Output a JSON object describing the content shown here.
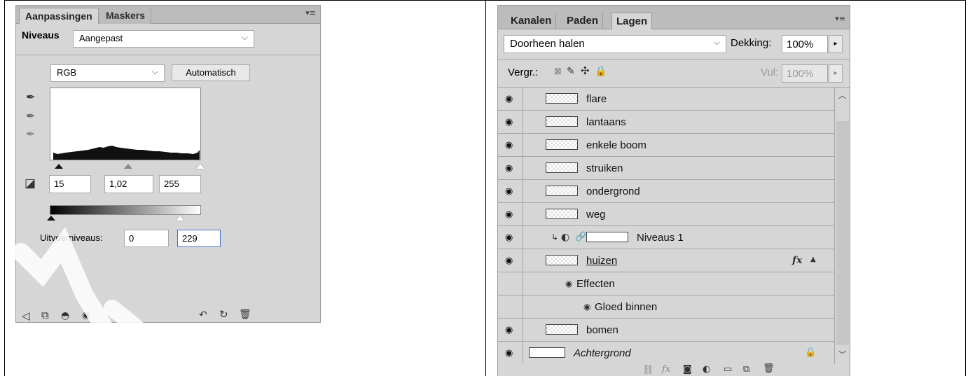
{
  "adjustments_panel": {
    "tabs": [
      {
        "label": "Aanpassingen",
        "active": true
      },
      {
        "label": "Maskers",
        "active": false
      }
    ],
    "preset_label": "Niveaus",
    "preset_value": "Aangepast",
    "channel_value": "RGB",
    "auto_button": "Automatisch",
    "input_levels": {
      "black": "15",
      "gamma": "1,02",
      "white": "255"
    },
    "output_label": "Uitvoerniveaus:",
    "output_levels": {
      "black": "0",
      "white": "229"
    }
  },
  "layers_panel": {
    "tabs": [
      {
        "label": "Kanalen",
        "active": false
      },
      {
        "label": "Paden",
        "active": false
      },
      {
        "label": "Lagen",
        "active": true
      }
    ],
    "blend_mode": "Doorheen halen",
    "opacity_label": "Dekking:",
    "opacity_value": "100%",
    "lock_label": "Vergr.:",
    "fill_label": "Vul:",
    "fill_value": "100%",
    "layers": [
      {
        "name": "flare",
        "visible": true
      },
      {
        "name": "lantaans",
        "visible": true
      },
      {
        "name": "enkele boom",
        "visible": true
      },
      {
        "name": "struiken",
        "visible": true
      },
      {
        "name": "ondergrond",
        "visible": true
      },
      {
        "name": "weg",
        "visible": true
      },
      {
        "name": "Niveaus 1",
        "visible": true,
        "adjustment": true
      },
      {
        "name": "huizen",
        "visible": true,
        "has_fx": true
      },
      {
        "name": "Effecten",
        "visible": true,
        "effect_group": true
      },
      {
        "name": "Gloed binnen",
        "visible": true,
        "effect": true
      },
      {
        "name": "bomen",
        "visible": true
      },
      {
        "name": "Achtergrond",
        "visible": true,
        "background": true
      }
    ]
  },
  "colors": {
    "panel_bg": "#d6d6d6",
    "tab_bar": "#bcbcbc",
    "focus_border": "#3b73c4"
  }
}
